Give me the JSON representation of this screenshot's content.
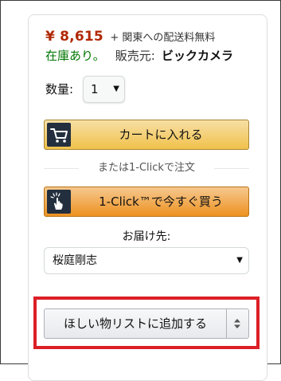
{
  "price": {
    "amount": "¥ 8,615",
    "shipping": "+ 関東への配送料無料"
  },
  "availability": {
    "stock": "在庫あり。",
    "seller_label": "販売元:",
    "seller_name": "ビックカメラ"
  },
  "quantity": {
    "label": "数量:",
    "value": "1"
  },
  "cart": {
    "label": "カートに入れる",
    "icon": "cart-icon"
  },
  "divider": {
    "text": "または1-Clickで注文"
  },
  "one_click": {
    "label": "1-Click™で今すぐ買う",
    "icon": "tap-hand-icon"
  },
  "delivery": {
    "label": "お届け先:",
    "value": "桜庭剛志"
  },
  "wishlist": {
    "label": "ほしい物リストに追加する",
    "dropdown_icon": "up-down-arrows-icon"
  },
  "colors": {
    "price": "#B12704",
    "stock": "#007600",
    "cart_button": "#F0C14B",
    "one_click_button": "#ED9220",
    "highlight": "#DC1F26"
  }
}
